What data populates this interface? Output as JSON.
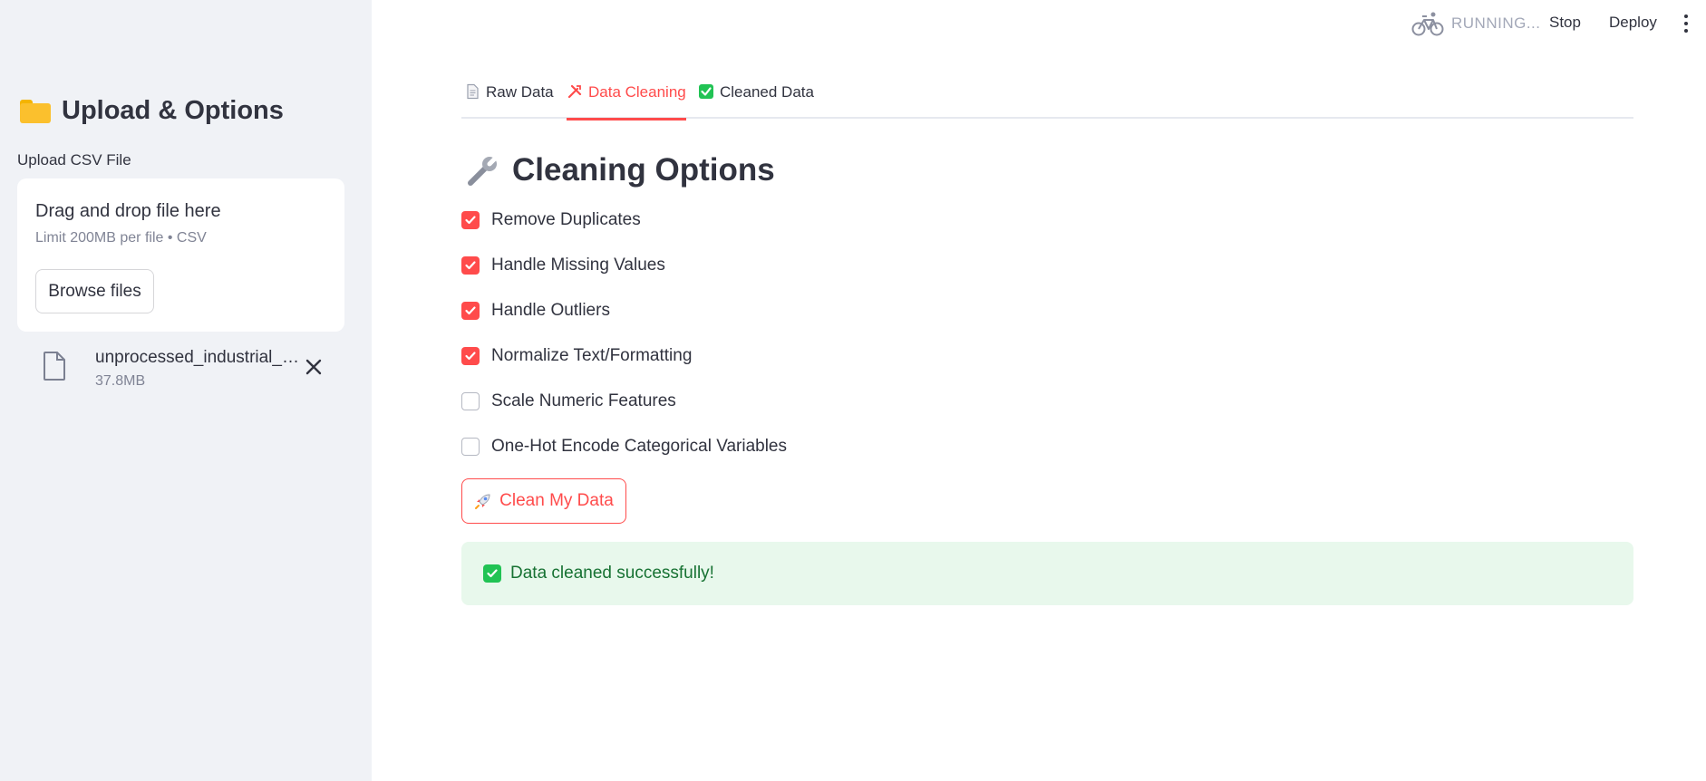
{
  "sidebar": {
    "title": "Upload & Options",
    "upload_label": "Upload CSV File",
    "dropzone": {
      "title": "Drag and drop file here",
      "limit": "Limit 200MB per file • CSV",
      "browse_label": "Browse files"
    },
    "file": {
      "name": "unprocessed_industrial_data.csv",
      "size": "37.8MB"
    }
  },
  "topbar": {
    "status": "RUNNING...",
    "stop_label": "Stop",
    "deploy_label": "Deploy"
  },
  "tabs": [
    {
      "label": "Raw Data",
      "icon": "document-icon",
      "active": false
    },
    {
      "label": "Data Cleaning",
      "icon": "tools-icon",
      "active": true
    },
    {
      "label": "Cleaned Data",
      "icon": "check-box-icon",
      "active": false
    }
  ],
  "main": {
    "heading": "Cleaning Options",
    "options": [
      {
        "label": "Remove Duplicates",
        "checked": true
      },
      {
        "label": "Handle Missing Values",
        "checked": true
      },
      {
        "label": "Handle Outliers",
        "checked": true
      },
      {
        "label": "Normalize Text/Formatting",
        "checked": true
      },
      {
        "label": "Scale Numeric Features",
        "checked": false
      },
      {
        "label": "One-Hot Encode Categorical Variables",
        "checked": false
      }
    ],
    "clean_button_label": "Clean My Data",
    "success_message": "Data cleaned successfully!"
  },
  "colors": {
    "accent": "#ff4b4b",
    "sidebar_bg": "#f0f2f6",
    "success_bg": "#e8f8ec",
    "success_text": "#177233",
    "success_icon": "#21c354"
  }
}
